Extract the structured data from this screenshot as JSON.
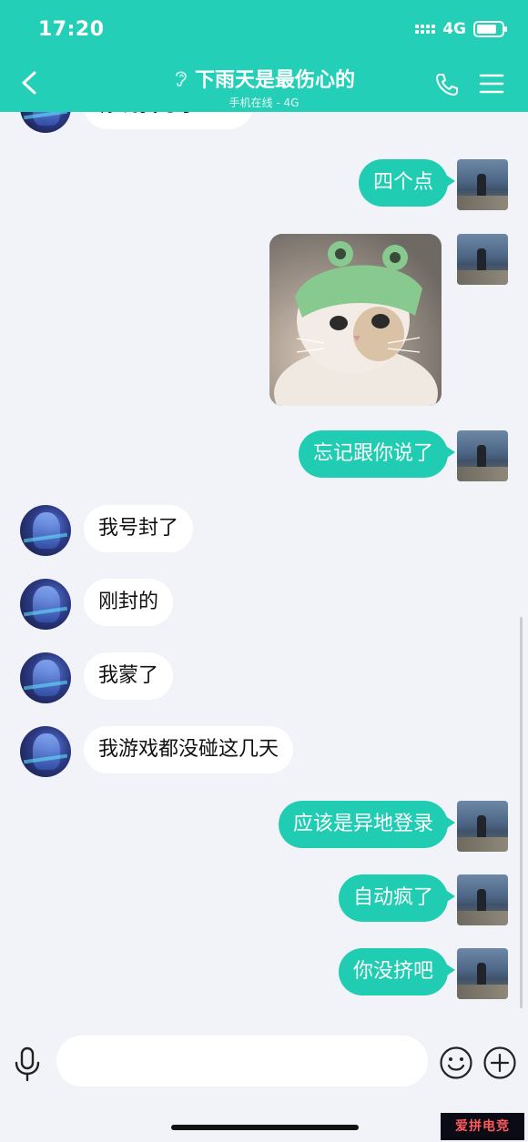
{
  "status_bar": {
    "time": "17:20",
    "network": "4G",
    "battery_level": 0.8
  },
  "header": {
    "title": "下雨天是最伤心的",
    "subtitle": "手机在线 - 4G"
  },
  "messages": [
    {
      "side": "left",
      "text": "你玩我号了？？",
      "partial": true
    },
    {
      "side": "right",
      "text": "四个点"
    },
    {
      "side": "right",
      "type": "image",
      "content": "cat-frog-hat-sticker"
    },
    {
      "side": "right",
      "text": "忘记跟你说了"
    },
    {
      "side": "left",
      "text": "我号封了"
    },
    {
      "side": "left",
      "text": "刚封的"
    },
    {
      "side": "left",
      "text": "我蒙了"
    },
    {
      "side": "left",
      "text": "我游戏都没碰这几天"
    },
    {
      "side": "right",
      "text": "应该是异地登录"
    },
    {
      "side": "right",
      "text": "自动疯了"
    },
    {
      "side": "right",
      "text": "你没挤吧"
    }
  ],
  "input": {
    "value": "",
    "placeholder": ""
  },
  "watermark": "爱拼电竞",
  "colors": {
    "accent": "#23cfb6",
    "bubble_right": "#20cdb2",
    "bubble_left": "#ffffff",
    "background": "#f1f3f8"
  }
}
